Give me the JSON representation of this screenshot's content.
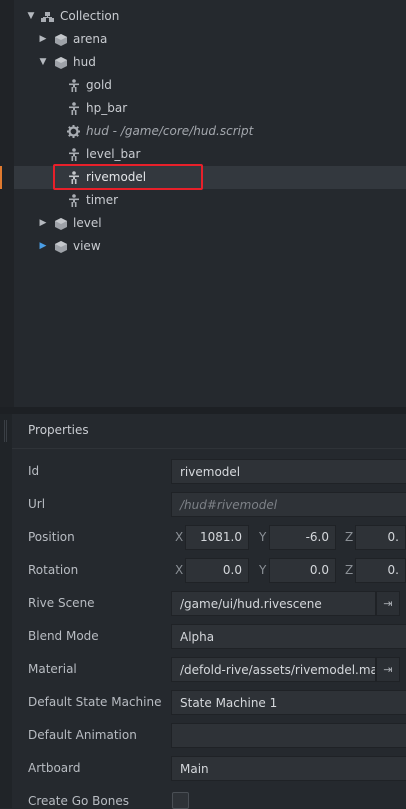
{
  "outline": {
    "items": [
      {
        "label": "Collection",
        "icon": "collection-icon",
        "expander": "expanded"
      },
      {
        "label": "arena",
        "icon": "game-object-icon",
        "expander": "collapsed"
      },
      {
        "label": "hud",
        "icon": "game-object-icon",
        "expander": "expanded"
      },
      {
        "label": "gold",
        "icon": "gui-node-icon",
        "expander": "none"
      },
      {
        "label": "hp_bar",
        "icon": "gui-node-icon",
        "expander": "none"
      },
      {
        "label": "hud - /game/core/hud.script",
        "icon": "script-gear-icon",
        "expander": "none"
      },
      {
        "label": "level_bar",
        "icon": "gui-node-icon",
        "expander": "none"
      },
      {
        "label": "rivemodel",
        "icon": "gui-node-icon",
        "expander": "none",
        "selected": true
      },
      {
        "label": "timer",
        "icon": "gui-node-icon",
        "expander": "none"
      },
      {
        "label": "level",
        "icon": "game-object-icon",
        "expander": "collapsed"
      },
      {
        "label": "view",
        "icon": "game-object-icon",
        "expander": "collapsed-blue"
      }
    ]
  },
  "properties": {
    "title": "Properties",
    "id_label": "Id",
    "id_value": "rivemodel",
    "url_label": "Url",
    "url_value": "/hud#rivemodel",
    "position_label": "Position",
    "position": {
      "x": "1081.0",
      "y": "-6.0",
      "z": "0."
    },
    "rotation_label": "Rotation",
    "rotation": {
      "x": "0.0",
      "y": "0.0",
      "z": "0."
    },
    "axis": {
      "x": "X",
      "y": "Y",
      "z": "Z"
    },
    "rive_scene_label": "Rive Scene",
    "rive_scene_value": "/game/ui/hud.rivescene",
    "blend_mode_label": "Blend Mode",
    "blend_mode_value": "Alpha",
    "material_label": "Material",
    "material_value": "/defold-rive/assets/rivemodel.mate",
    "default_state_machine_label": "Default State Machine",
    "default_state_machine_value": "State Machine 1",
    "default_animation_label": "Default Animation",
    "default_animation_value": "",
    "artboard_label": "Artboard",
    "artboard_value": "Main",
    "create_go_bones_label": "Create Go Bones"
  },
  "colors": {
    "selection_border": "#e8202a",
    "accent": "#e07a2f",
    "blue_expander": "#4a9ee6"
  }
}
